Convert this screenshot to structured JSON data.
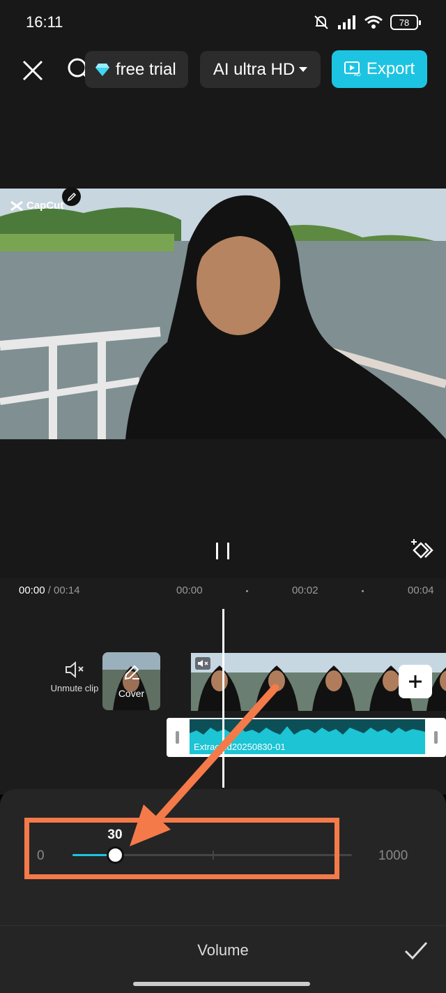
{
  "status_bar": {
    "time": "16:11",
    "battery": "78"
  },
  "toolbar": {
    "trial_label": "free trial",
    "quality_label": "AI ultra HD",
    "export_label": "Export"
  },
  "preview": {
    "watermark": "CapCut"
  },
  "timeline": {
    "current_time": "00:00",
    "total_time": "/ 00:14",
    "ruler": [
      "00:00",
      "00:02",
      "00:04"
    ],
    "unmute_label": "Unmute clip",
    "cover_label": "Cover",
    "audio_label": "Extracted20250830-01"
  },
  "volume": {
    "min_label": "0",
    "max_label": "1000",
    "value": "30",
    "level_fraction": 0.152,
    "title": "Volume"
  },
  "colors": {
    "accent": "#1cc4e2",
    "highlight": "#f47a4a",
    "panel": "#252525"
  }
}
